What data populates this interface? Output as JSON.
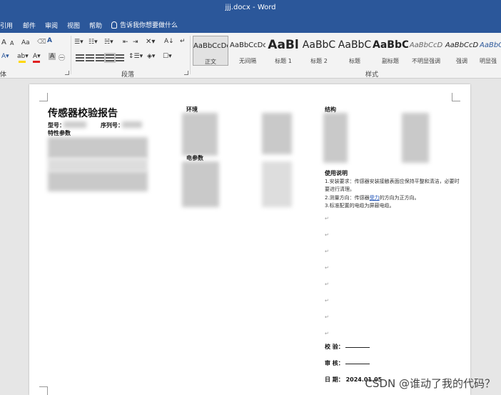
{
  "window": {
    "title": "jjj.docx - Word"
  },
  "ribbon_tabs": [
    "引用",
    "邮件",
    "审阅",
    "视图",
    "帮助"
  ],
  "tell_me": "告诉我你想要做什么",
  "groups": {
    "font": "体",
    "paragraph": "段落",
    "styles": "样式"
  },
  "font_controls": {
    "grow": "A",
    "shrink": "A",
    "case": "Aa"
  },
  "styles": [
    {
      "sample": "AaBbCcDc",
      "name": "正文"
    },
    {
      "sample": "AaBbCcDc",
      "name": "无间隔"
    },
    {
      "sample": "AaBl",
      "name": "标题 1"
    },
    {
      "sample": "AaBbC",
      "name": "标题 2"
    },
    {
      "sample": "AaBbC",
      "name": "标题"
    },
    {
      "sample": "AaBbC",
      "name": "副标题"
    },
    {
      "sample": "AaBbCcD",
      "name": "不明显强调"
    },
    {
      "sample": "AaBbCcD",
      "name": "强调"
    },
    {
      "sample": "AaBbCc",
      "name": "明显强"
    }
  ],
  "document": {
    "title": "传感器校验报告",
    "model_label": "型号：",
    "serial_label": "序列号：",
    "params_label": "特性参数",
    "env_label": "环境",
    "elec_label": "电参数",
    "struct_label": "结构",
    "usage_title": "使用说明",
    "usage_items": [
      "1.安装要求：传感器安装接触表面应保持平整和清洁，必要时要进行清理。",
      "2.测量方向：传感器受力的方向为正方向。",
      "3.标准配置的电缆为屏蔽电缆。"
    ],
    "usage_link": "受力",
    "check_label": "校  验：",
    "review_label": "审  核：",
    "date_label": "日  期：",
    "date_value": "2024.01.05"
  },
  "watermark": "CSDN @谁动了我的代码？"
}
